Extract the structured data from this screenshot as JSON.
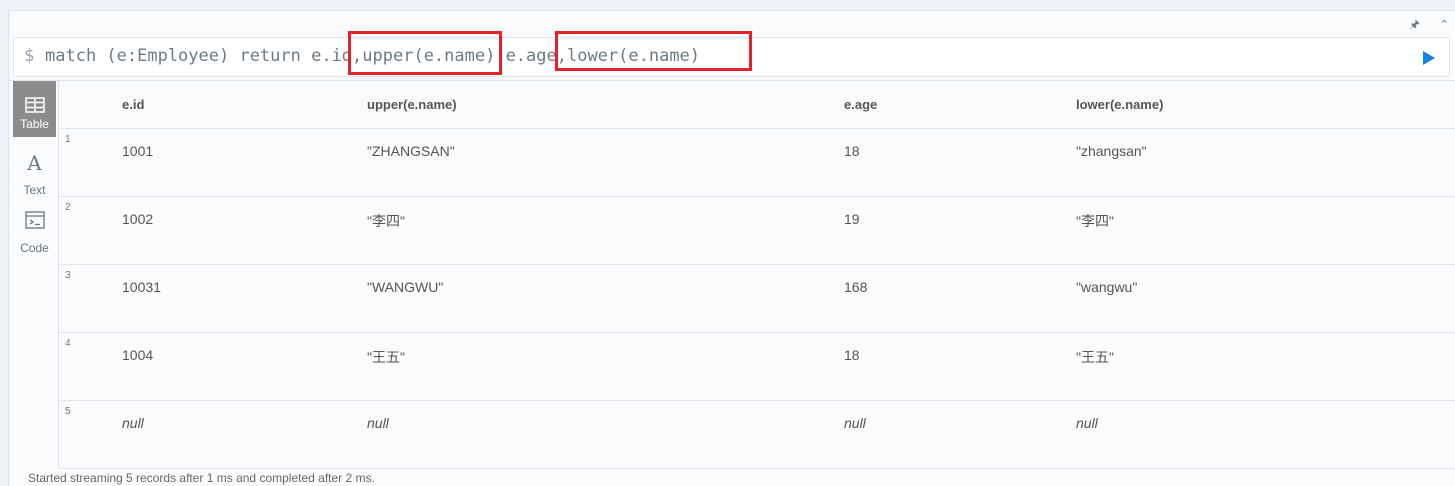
{
  "toolbar": {
    "pin_icon": "pin-icon",
    "collapse_icon": "chevron-up-icon"
  },
  "editor": {
    "prompt": "$",
    "query": "match (e:Employee) return e.id,upper(e.name),e.age,lower(e.name)",
    "run_icon": "play-icon",
    "highlight_color": "#e52129"
  },
  "views": [
    {
      "label": "Table",
      "icon": "table-icon",
      "active": true
    },
    {
      "label": "Text",
      "icon": "text-icon",
      "active": false
    },
    {
      "label": "Code",
      "icon": "code-icon",
      "active": false
    }
  ],
  "table": {
    "columns": [
      "e.id",
      "upper(e.name)",
      "e.age",
      "lower(e.name)"
    ],
    "rows": [
      {
        "num": "1",
        "cells": [
          "1001",
          "\"ZHANGSAN\"",
          "18",
          "\"zhangsan\""
        ]
      },
      {
        "num": "2",
        "cells": [
          "1002",
          "\"李四\"",
          "19",
          "\"李四\""
        ]
      },
      {
        "num": "3",
        "cells": [
          "10031",
          "\"WANGWU\"",
          "168",
          "\"wangwu\""
        ]
      },
      {
        "num": "4",
        "cells": [
          "1004",
          "\"王五\"",
          "18",
          "\"王五\""
        ]
      },
      {
        "num": "5",
        "cells": [
          "null",
          "null",
          "null",
          "null"
        ]
      }
    ]
  },
  "status": "Started streaming 5 records after 1 ms and completed after 2 ms."
}
